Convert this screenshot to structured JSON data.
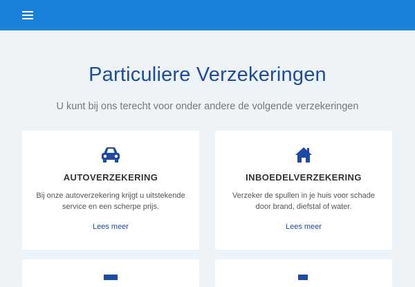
{
  "nav": {
    "menu_icon": "hamburger-menu-icon",
    "bar_color": "#1a82d9"
  },
  "page": {
    "title": "Particuliere Verzekeringen",
    "subtitle": "U kunt bij ons terecht voor onder andere de volgende verzekeringen"
  },
  "colors": {
    "accent": "#1f4aa3",
    "background": "#eef3f7"
  },
  "cards": [
    {
      "icon": "car-icon",
      "title": "AUTOVERZEKERING",
      "description": "Bij onze autoverzekering krijgt u uitstekende service en een scherpe prijs.",
      "link": "Lees meer"
    },
    {
      "icon": "home-icon",
      "title": "INBOEDELVERZEKERING",
      "description": "Verzeker de spullen in je huis voor schade door brand, diefstal of water.",
      "link": "Lees meer"
    }
  ]
}
